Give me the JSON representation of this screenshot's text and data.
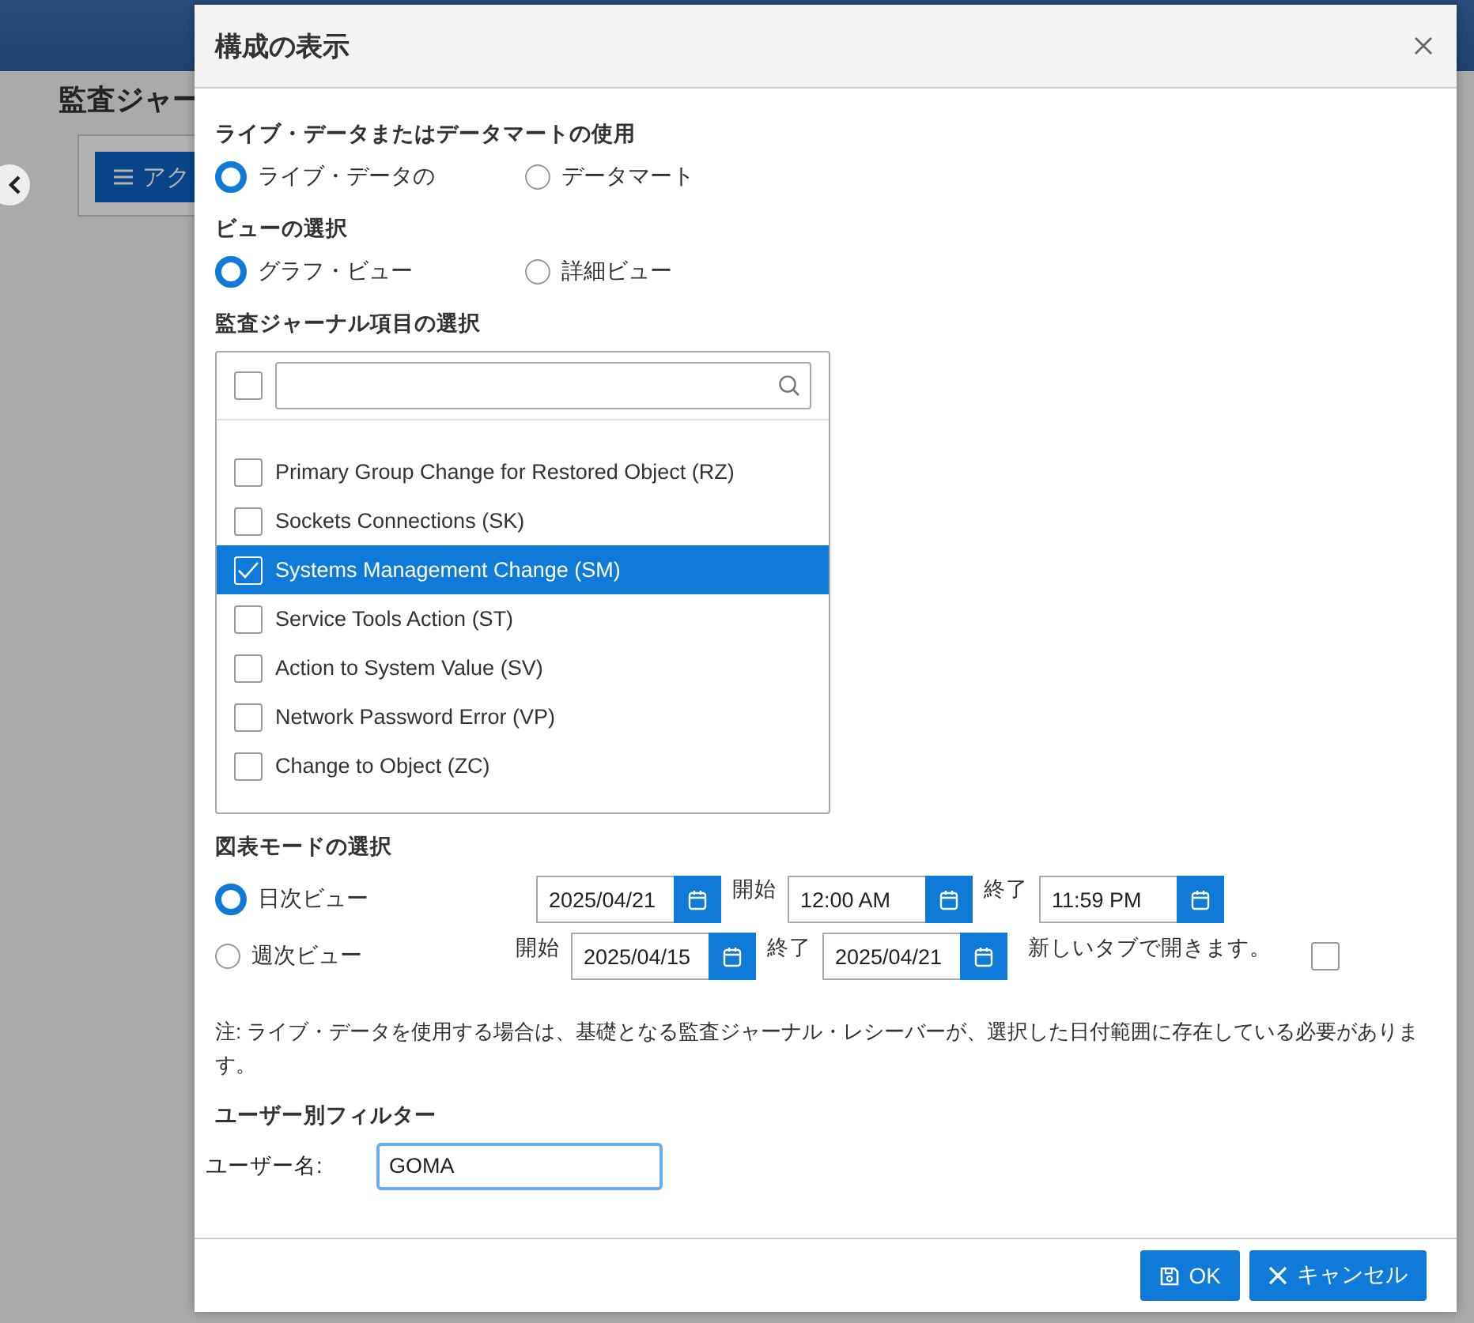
{
  "background": {
    "page_title": "監査ジャー",
    "action_button": "アク"
  },
  "dialog": {
    "title": "構成の表示",
    "source": {
      "label": "ライブ・データまたはデータマートの使用",
      "options": [
        {
          "label": "ライブ・データの",
          "selected": true
        },
        {
          "label": "データマート",
          "selected": false
        }
      ]
    },
    "view": {
      "label": "ビューの選択",
      "options": [
        {
          "label": "グラフ・ビュー",
          "selected": true
        },
        {
          "label": "詳細ビュー",
          "selected": false
        }
      ]
    },
    "items": {
      "label": "監査ジャーナル項目の選択",
      "select_all_checked": false,
      "entries": [
        {
          "label": "Primary Group Change for Restored Object (RZ)",
          "checked": false,
          "selected": false
        },
        {
          "label": "Sockets Connections (SK)",
          "checked": false,
          "selected": false
        },
        {
          "label": "Systems Management Change (SM)",
          "checked": true,
          "selected": true
        },
        {
          "label": "Service Tools Action (ST)",
          "checked": false,
          "selected": false
        },
        {
          "label": "Action to System Value (SV)",
          "checked": false,
          "selected": false
        },
        {
          "label": "Network Password Error (VP)",
          "checked": false,
          "selected": false
        },
        {
          "label": "Change to Object (ZC)",
          "checked": false,
          "selected": false
        }
      ]
    },
    "chart_mode": {
      "label": "図表モードの選択",
      "modes": [
        {
          "label": "日次ビュー",
          "selected": true,
          "fields": [
            {
              "kind": "picker",
              "value": "2025/04/21"
            },
            {
              "kind": "label",
              "text": "開始"
            },
            {
              "kind": "picker",
              "value": "12:00 AM"
            },
            {
              "kind": "label",
              "text": "終了"
            },
            {
              "kind": "picker",
              "value": "11:59 PM"
            }
          ]
        },
        {
          "label": "週次ビュー",
          "selected": false,
          "fields": [
            {
              "kind": "label",
              "text": "開始"
            },
            {
              "kind": "picker",
              "value": "2025/04/15"
            },
            {
              "kind": "label",
              "text": "終了"
            },
            {
              "kind": "picker",
              "value": "2025/04/21"
            }
          ]
        }
      ],
      "new_tab": {
        "label": "新しいタブで開きます。",
        "checked": false
      }
    },
    "note": "注: ライブ・データを使用する場合は、基礎となる監査ジャーナル・レシーバーが、選択した日付範囲に存在している必要があります。",
    "filter": {
      "label": "ユーザー別フィルター",
      "field_label": "ユーザー名:",
      "value": "GOMA"
    },
    "buttons": [
      {
        "label": "OK",
        "kind": "save"
      },
      {
        "label": "キャンセル",
        "kind": "cancel"
      }
    ]
  }
}
